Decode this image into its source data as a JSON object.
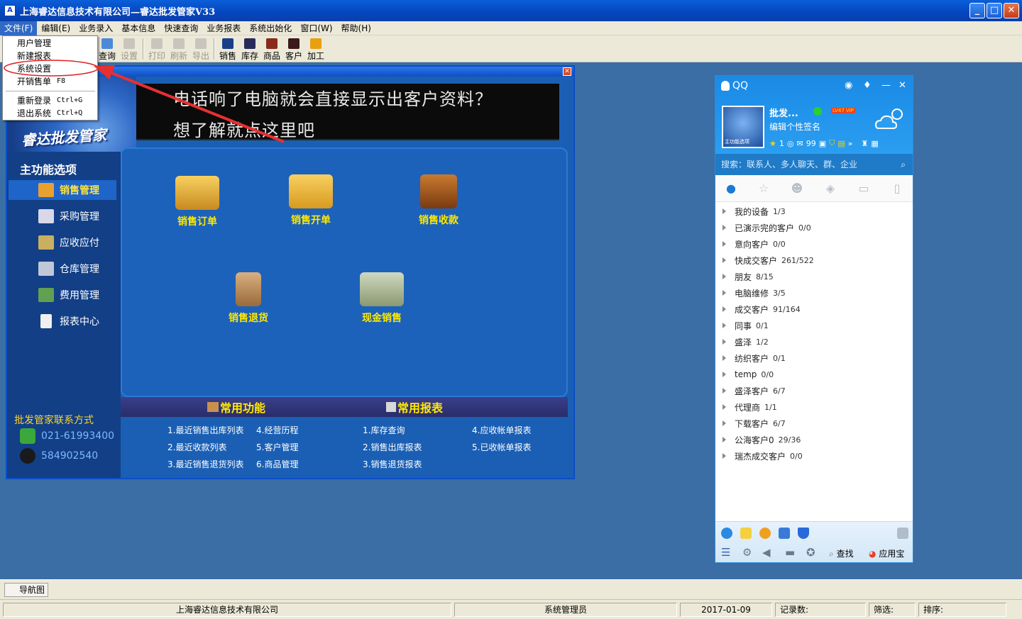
{
  "window": {
    "title": "上海睿达信息技术有限公司—睿达批发管家V33",
    "icon_letter": "A",
    "controls": {
      "minimize": "_",
      "maximize": "□",
      "close": "✕"
    }
  },
  "menubar": [
    "文件(F)",
    "编辑(E)",
    "业务录入",
    "基本信息",
    "快速查询",
    "业务报表",
    "系统出始化",
    "窗口(W)",
    "帮助(H)"
  ],
  "toolbar": {
    "query": "查询",
    "settings": "设置",
    "print": "打印",
    "refresh": "刷新",
    "export": "导出",
    "sales": "销售",
    "stock": "库存",
    "goods": "商品",
    "customer": "客户",
    "process": "加工"
  },
  "file_menu": {
    "user_manage": "用户管理",
    "new_report": "新建报表",
    "system_settings": "系统设置",
    "sales_invoice": "开销售单",
    "sales_invoice_shortcut": "F8",
    "relogin": "重新登录",
    "relogin_shortcut": "Ctrl+G",
    "exit": "退出系统",
    "exit_shortcut": "Ctrl+Q"
  },
  "banner": {
    "logo": "睿达批发管家",
    "line1": "电话响了电脑就会直接显示出客户资料？",
    "line2": "想了解就点这里吧"
  },
  "sidebar": {
    "title": "主功能选项",
    "items": [
      {
        "label": "销售管理",
        "color": "#e8a030"
      },
      {
        "label": "采购管理",
        "color": "#d8d8e8"
      },
      {
        "label": "应收应付",
        "color": "#c8b060"
      },
      {
        "label": "仓库管理",
        "color": "#c0c8d8"
      },
      {
        "label": "费用管理",
        "color": "#60a050"
      },
      {
        "label": "报表中心",
        "color": "#f0f0f0"
      }
    ],
    "contact_title": "批发管家联系方式",
    "phone": "021-61993400",
    "qq": "584902540"
  },
  "functions": {
    "sales_order": "销售订单",
    "sales_invoice": "销售开单",
    "sales_collection": "销售收款",
    "sales_return": "销售退货",
    "cash_sales": "现金销售"
  },
  "common": {
    "functions_title": "常用功能",
    "reports_title": "常用报表",
    "func_links": [
      "1.最近销售出库列表",
      "4.经营历程",
      "2.最近收款列表",
      "5.客户管理",
      "3.最近销售退货列表",
      "6.商品管理"
    ],
    "report_links": [
      "1.库存查询",
      "4.应收帐单报表",
      "2.销售出库报表",
      "5.已收帐单报表",
      "3.销售退货报表"
    ]
  },
  "qq": {
    "app_name": "QQ",
    "nickname": "批发...",
    "level": "LV47",
    "vip": "VIP",
    "signature": "编辑个性签名",
    "avatar_caption": "主功能选项",
    "stats": {
      "stars": "1",
      "mail": "99"
    },
    "search_placeholder": "搜索：联系人、多人聊天、群、企业",
    "groups": [
      {
        "name": "我的设备",
        "count": "1/3"
      },
      {
        "name": "已演示完的客户",
        "count": "0/0"
      },
      {
        "name": "意向客户",
        "count": "0/0"
      },
      {
        "name": "快成交客户",
        "count": "261/522"
      },
      {
        "name": "朋友",
        "count": "8/15"
      },
      {
        "name": "电脑维修",
        "count": "3/5"
      },
      {
        "name": "成交客户",
        "count": "91/164"
      },
      {
        "name": "同事",
        "count": "0/1"
      },
      {
        "name": "盛泽",
        "count": "1/2"
      },
      {
        "name": "纺织客户",
        "count": "0/1"
      },
      {
        "name": "temp",
        "count": "0/0"
      },
      {
        "name": "盛泽客户",
        "count": "6/7"
      },
      {
        "name": "代理商",
        "count": "1/1"
      },
      {
        "name": "下载客户",
        "count": "6/7"
      },
      {
        "name": "公海客户0",
        "count": "29/36"
      },
      {
        "name": "瑞杰成交客户",
        "count": "0/0"
      }
    ],
    "find_label": "查找",
    "appbox_label": "应用宝"
  },
  "navtab": "导航图",
  "status": {
    "company": "上海睿达信息技术有限公司",
    "user": "系统管理员",
    "date": "2017-01-09",
    "records": "记录数:",
    "filter": "筛选:",
    "sort": "排序:"
  }
}
